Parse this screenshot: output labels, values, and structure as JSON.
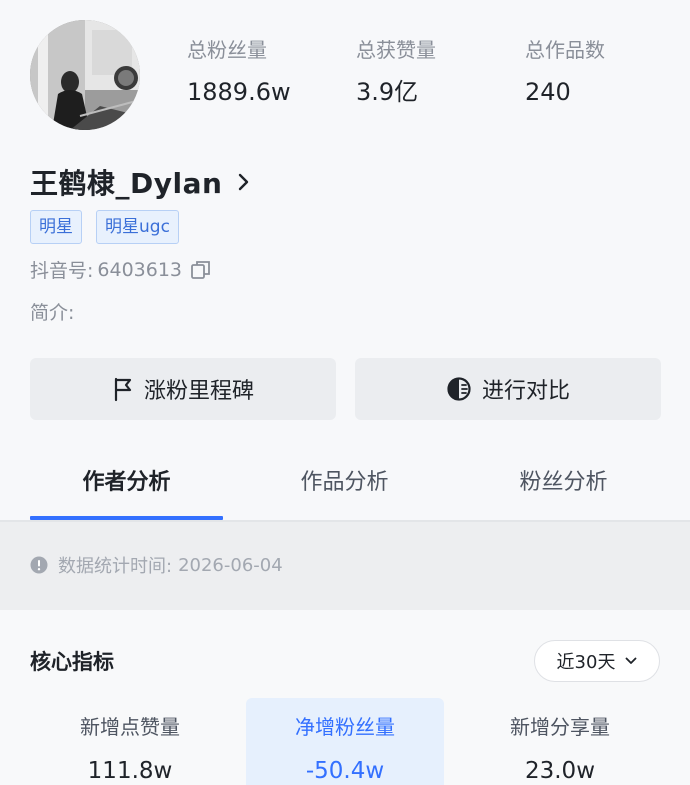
{
  "profile": {
    "stats": [
      {
        "label": "总粉丝量",
        "value": "1889.6w"
      },
      {
        "label": "总获赞量",
        "value": "3.9亿"
      },
      {
        "label": "总作品数",
        "value": "240"
      }
    ],
    "name": "王鹤棣_Dylan",
    "tags": [
      "明星",
      "明星ugc"
    ],
    "douyin_label": "抖音号:",
    "douyin_id": "6403613",
    "intro_label": "简介:"
  },
  "actions": {
    "milestone_label": "涨粉里程碑",
    "compare_label": "进行对比"
  },
  "tabs": [
    {
      "label": "作者分析",
      "active": true
    },
    {
      "label": "作品分析",
      "active": false
    },
    {
      "label": "粉丝分析",
      "active": false
    }
  ],
  "notice": {
    "label": "数据统计时间:",
    "date": "2026-06-04"
  },
  "core": {
    "title": "核心指标",
    "range": "近30天",
    "metrics": [
      {
        "label": "新增点赞量",
        "value": "111.8w"
      },
      {
        "label": "净增粉丝量",
        "value": "-50.4w",
        "highlight": true
      },
      {
        "label": "新增分享量",
        "value": "23.0w"
      }
    ]
  },
  "colors": {
    "accent": "#3370ff",
    "tag_text": "#3a6fd8",
    "muted_text": "#8a8f99"
  },
  "icons": [
    "flag-icon",
    "compare-icon",
    "copy-icon",
    "info-icon",
    "chevron-right-icon",
    "chevron-down-icon"
  ]
}
